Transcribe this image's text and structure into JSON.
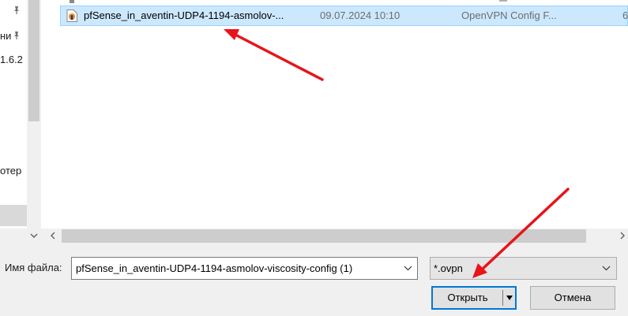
{
  "nav": {
    "items": [
      {
        "label": "ни",
        "pinned": true
      },
      {
        "label": "1.6.2",
        "pinned": false
      },
      {
        "label": "отер",
        "pinned": false
      }
    ],
    "pin_icon": "pin-icon"
  },
  "file_list": {
    "selected_row": {
      "icon": "openvpn-config-file-icon",
      "name": "pfSense_in_aventin-UDP4-1194-asmolov-...",
      "date": "09.07.2024 10:10",
      "type": "OpenVPN Config F...",
      "size": "6"
    }
  },
  "bottom_bar": {
    "filename_label": "Имя файла:",
    "filename_value": "pfSense_in_aventin-UDP4-1194-asmolov-viscosity-config (1)",
    "filter_value": "*.ovpn",
    "open_label": "Открыть",
    "cancel_label": "Отмена"
  },
  "colors": {
    "selection_bg": "#cce8ff",
    "selection_border": "#99d1ff",
    "default_button_border": "#0078d7",
    "annotation_arrow": "#e8141b"
  }
}
